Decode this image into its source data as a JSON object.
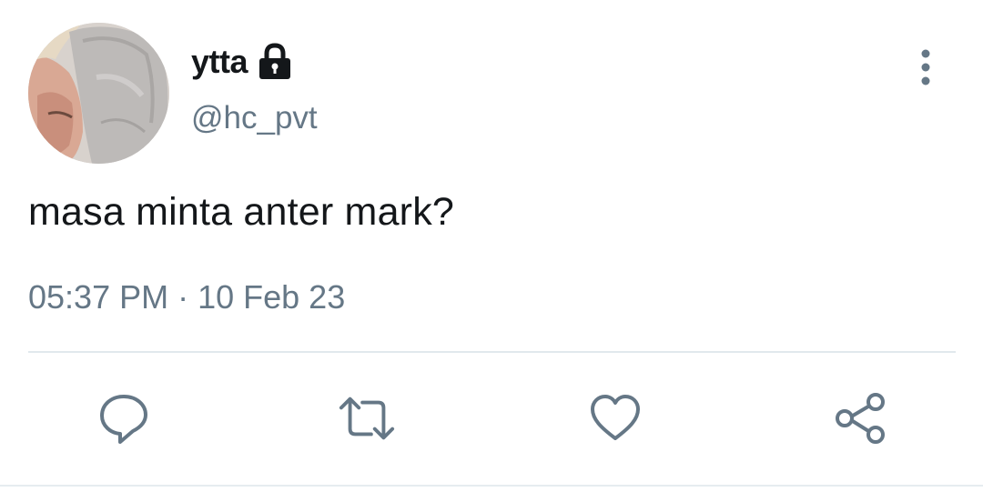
{
  "user": {
    "display_name": "ytta",
    "handle": "@hc_pvt",
    "protected": true
  },
  "tweet": {
    "text": "masa minta anter mark?",
    "time": "05:37 PM",
    "separator": "·",
    "date": "10 Feb 23"
  },
  "icons": {
    "menu": "more-vertical-icon",
    "lock": "lock-icon",
    "reply": "reply-icon",
    "retweet": "retweet-icon",
    "like": "heart-icon",
    "share": "share-icon"
  },
  "colors": {
    "text_primary": "#14171a",
    "text_secondary": "#657786",
    "divider": "#e1e8ed"
  }
}
